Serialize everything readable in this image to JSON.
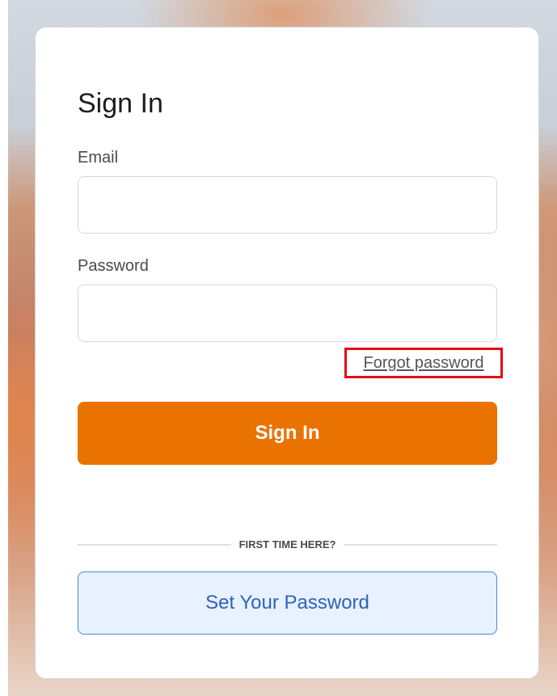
{
  "page": {
    "background_description": "blurred warm background"
  },
  "signin_form": {
    "title": "Sign In",
    "email_label": "Email",
    "email_value": "",
    "email_placeholder": "",
    "password_label": "Password",
    "password_value": "",
    "password_placeholder": "",
    "forgot_password": "Forgot password",
    "submit_label": "Sign In",
    "first_time_text": "FIRST TIME HERE?",
    "set_password_label": "Set Your Password"
  },
  "colors": {
    "primary_orange": "#ea7200",
    "secondary_blue_text": "#2e63bc",
    "secondary_blue_border": "#4d87d5",
    "secondary_blue_bg": "#e7f1ff",
    "highlight_red": "#e40b17"
  }
}
